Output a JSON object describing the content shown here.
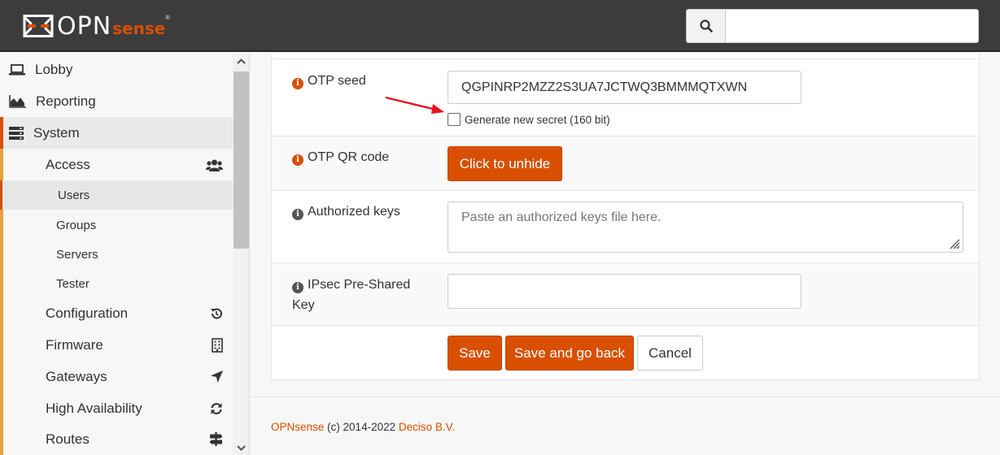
{
  "header": {
    "logo_main": "OPN",
    "logo_sub": "sense",
    "logo_reg": "®",
    "search_placeholder": ""
  },
  "sidebar": {
    "lobby": "Lobby",
    "reporting": "Reporting",
    "system": "System",
    "access": "Access",
    "access_items": [
      "Users",
      "Groups",
      "Servers",
      "Tester"
    ],
    "configuration": "Configuration",
    "firmware": "Firmware",
    "gateways": "Gateways",
    "high_availability": "High Availability",
    "routes": "Routes"
  },
  "form": {
    "otp_seed_label": "OTP seed",
    "otp_seed_value": "QGPINRP2MZZ2S3UA7JCTWQ3BMMMQTXWN",
    "generate_label": "Generate new secret (160 bit)",
    "otp_qr_label": "OTP QR code",
    "unhide_button": "Click to unhide",
    "authorized_keys_label": "Authorized keys",
    "authorized_keys_placeholder": "Paste an authorized keys file here.",
    "ipsec_label_line1": "IPsec Pre-Shared",
    "ipsec_label_line2": "Key",
    "ipsec_value": "",
    "save_button": "Save",
    "save_back_button": "Save and go back",
    "cancel_button": "Cancel"
  },
  "footer": {
    "brand": "OPNsense",
    "copyright": "(c) 2014-2022",
    "company": "Deciso B.V."
  },
  "colors": {
    "accent": "#d94f00",
    "header_bg": "#3c3c3c",
    "annotation_arrow": "#e8121c"
  }
}
